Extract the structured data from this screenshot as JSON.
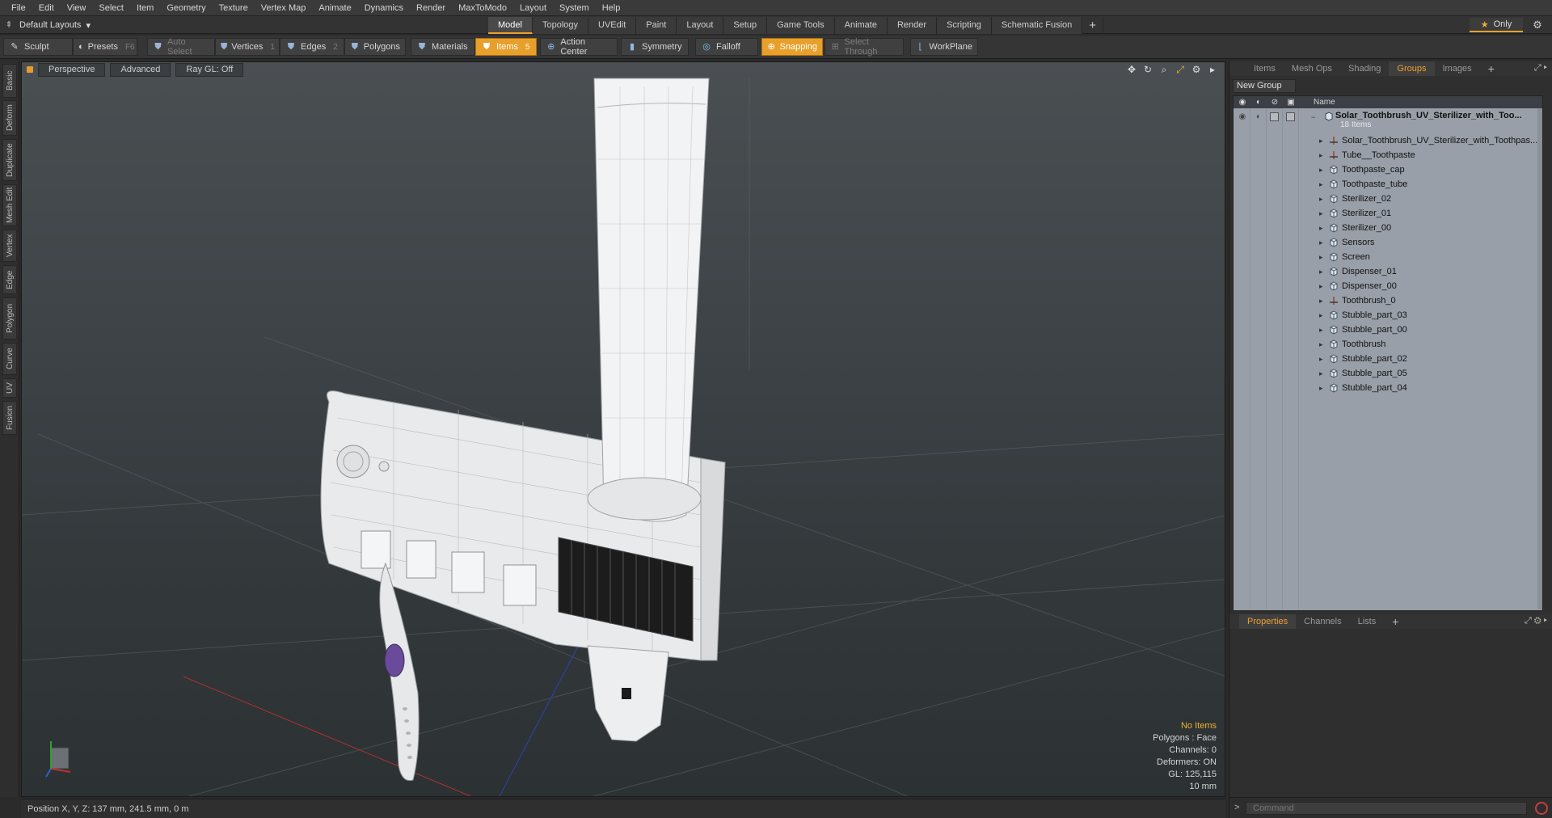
{
  "menu": [
    "File",
    "Edit",
    "View",
    "Select",
    "Item",
    "Geometry",
    "Texture",
    "Vertex Map",
    "Animate",
    "Dynamics",
    "Render",
    "MaxToModo",
    "Layout",
    "System",
    "Help"
  ],
  "layout_selector": "Default Layouts",
  "tabs": [
    "Model",
    "Topology",
    "UVEdit",
    "Paint",
    "Layout",
    "Setup",
    "Game Tools",
    "Animate",
    "Render",
    "Scripting",
    "Schematic Fusion"
  ],
  "active_tab": "Model",
  "only_label": "Only",
  "toolbar": {
    "sculpt": "Sculpt",
    "presets": "Presets",
    "presets_key": "F6",
    "auto_select": "Auto Select",
    "vertices": "Vertices",
    "vertices_count": "1",
    "edges": "Edges",
    "edges_count": "2",
    "polygons": "Polygons",
    "materials": "Materials",
    "items": "Items",
    "items_count": "5",
    "action_center": "Action Center",
    "symmetry": "Symmetry",
    "falloff": "Falloff",
    "snapping": "Snapping",
    "select_through": "Select Through",
    "workplane": "WorkPlane"
  },
  "left_tabs": [
    "Basic",
    "Deform",
    "Duplicate",
    "Mesh Edit",
    "Vertex",
    "Edge",
    "Polygon",
    "Curve",
    "UV",
    "Fusion"
  ],
  "viewport": {
    "view": "Perspective",
    "shading": "Advanced",
    "raygl": "Ray GL: Off",
    "info": {
      "selection": "No Items",
      "polygons": "Polygons : Face",
      "channels": "Channels: 0",
      "deformers": "Deformers: ON",
      "gl": "GL: 125,115",
      "scale": "10 mm"
    }
  },
  "status": "Position X, Y, Z:  137 mm, 241.5 mm, 0 m",
  "right_panel": {
    "tabs": [
      "Items",
      "Mesh Ops",
      "Shading",
      "Groups",
      "Images"
    ],
    "active_tab": "Groups",
    "new_group": "New Group",
    "column_name": "Name",
    "group": {
      "name": "Solar_Toothbrush_UV_Sterilizer_with_Too...",
      "count": "18 Items"
    },
    "items": [
      {
        "name": "Solar_Toothbrush_UV_Sterilizer_with_Toothpas...",
        "type": "locator"
      },
      {
        "name": "Tube__Toothpaste",
        "type": "locator"
      },
      {
        "name": "Toothpaste_cap",
        "type": "mesh"
      },
      {
        "name": "Toothpaste_tube",
        "type": "mesh"
      },
      {
        "name": "Sterilizer_02",
        "type": "mesh"
      },
      {
        "name": "Sterilizer_01",
        "type": "mesh"
      },
      {
        "name": "Sterilizer_00",
        "type": "mesh"
      },
      {
        "name": "Sensors",
        "type": "mesh"
      },
      {
        "name": "Screen",
        "type": "mesh"
      },
      {
        "name": "Dispenser_01",
        "type": "mesh"
      },
      {
        "name": "Dispenser_00",
        "type": "mesh"
      },
      {
        "name": "Toothbrush_0",
        "type": "locator"
      },
      {
        "name": "Stubble_part_03",
        "type": "mesh"
      },
      {
        "name": "Stubble_part_00",
        "type": "mesh"
      },
      {
        "name": "Toothbrush",
        "type": "mesh"
      },
      {
        "name": "Stubble_part_02",
        "type": "mesh"
      },
      {
        "name": "Stubble_part_05",
        "type": "mesh"
      },
      {
        "name": "Stubble_part_04",
        "type": "mesh"
      }
    ],
    "bottom_tabs": [
      "Properties",
      "Channels",
      "Lists"
    ],
    "bottom_active": "Properties",
    "command_placeholder": "Command"
  },
  "colors": {
    "accent": "#f0a030",
    "viewport_bg": "#3e4447",
    "list_bg": "#999fa8"
  }
}
